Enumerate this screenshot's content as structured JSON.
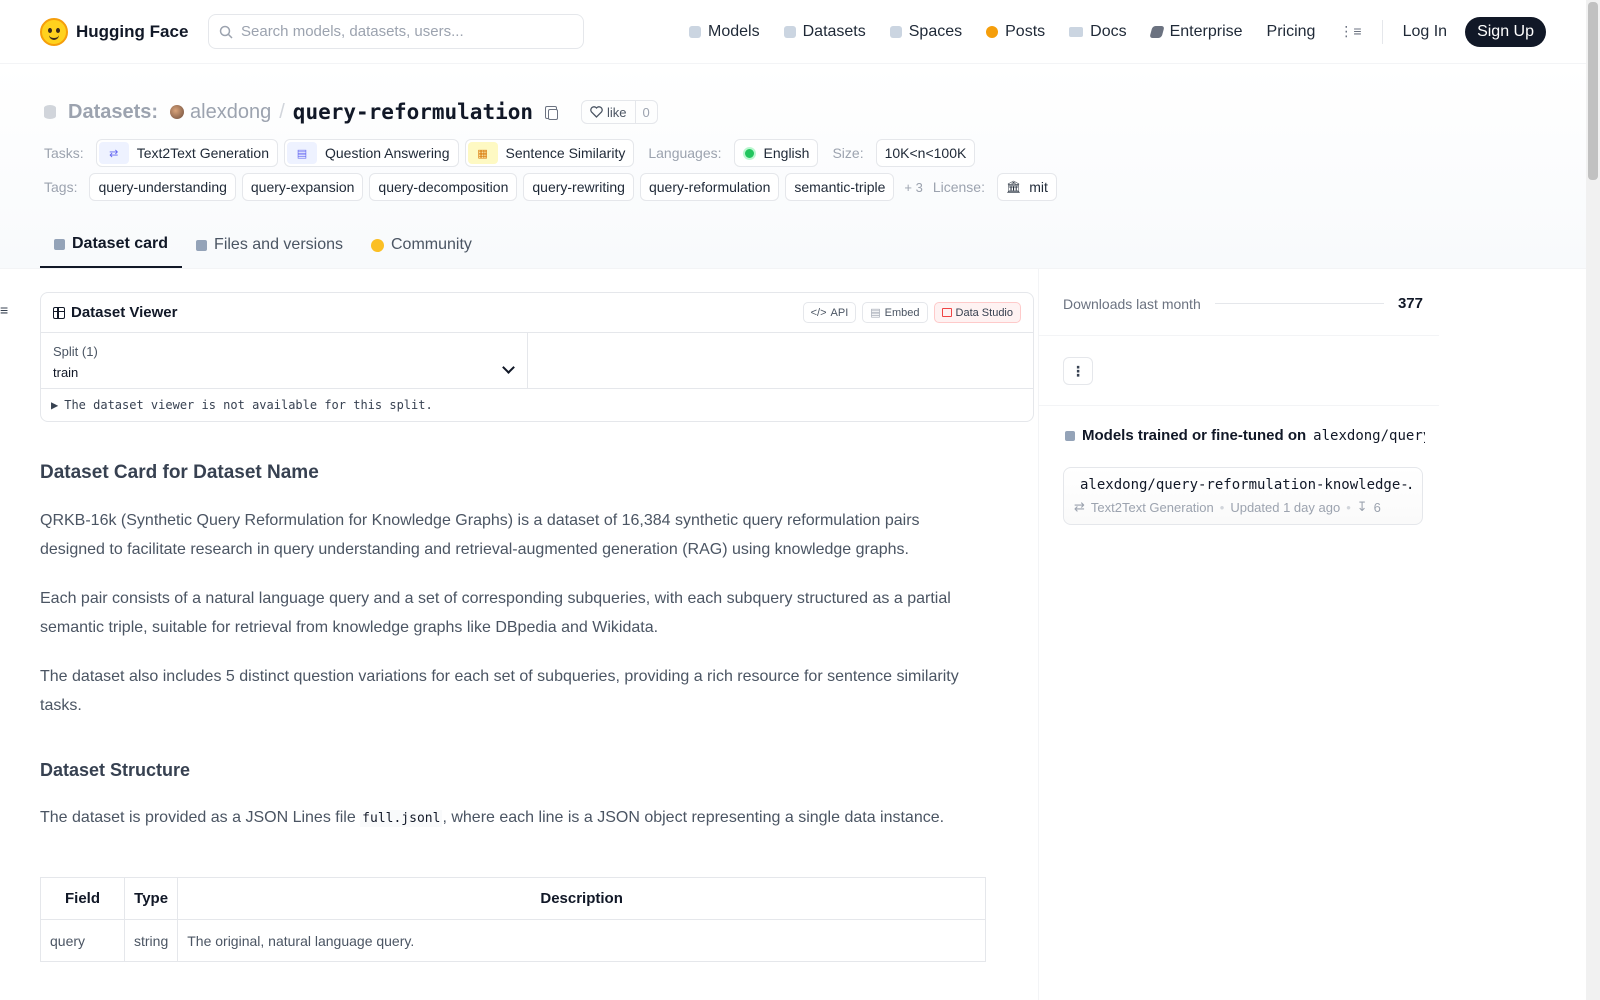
{
  "header": {
    "brand": "Hugging Face",
    "search_placeholder": "Search models, datasets, users...",
    "nav": [
      {
        "label": "Models",
        "icon": "cube-icon"
      },
      {
        "label": "Datasets",
        "icon": "database-icon"
      },
      {
        "label": "Spaces",
        "icon": "grid-icon"
      },
      {
        "label": "Posts",
        "icon": "bubble-icon"
      },
      {
        "label": "Docs",
        "icon": "book-icon"
      },
      {
        "label": "Enterprise",
        "icon": "enterprise-icon"
      },
      {
        "label": "Pricing"
      }
    ],
    "login": "Log In",
    "signup": "Sign Up"
  },
  "repo": {
    "type_label": "Datasets:",
    "owner": "alexdong",
    "slash": "/",
    "name": "query-reformulation",
    "like_label": "like",
    "like_count": "0"
  },
  "meta": {
    "tasks_label": "Tasks:",
    "tasks": [
      "Text2Text Generation",
      "Question Answering",
      "Sentence Similarity"
    ],
    "languages_label": "Languages:",
    "language": "English",
    "size_label": "Size:",
    "size": "10K<n<100K",
    "tags_label": "Tags:",
    "tags": [
      "query-understanding",
      "query-expansion",
      "query-decomposition",
      "query-rewriting",
      "query-reformulation",
      "semantic-triple"
    ],
    "more_tags": "+ 3",
    "license_label": "License:",
    "license": "mit"
  },
  "tabs": [
    "Dataset card",
    "Files and versions",
    "Community"
  ],
  "viewer": {
    "title": "Dataset Viewer",
    "api": "API",
    "embed": "Embed",
    "studio": "Data Studio",
    "split_label": "Split (1)",
    "split_value": "train",
    "note": "The dataset viewer is not available for this split."
  },
  "card": {
    "h2": "Dataset Card for Dataset Name",
    "p1": "QRKB-16k (Synthetic Query Reformulation for Knowledge Graphs) is a dataset of 16,384 synthetic query reformulation pairs designed to facilitate research in query understanding and retrieval-augmented generation (RAG) using knowledge graphs.",
    "p2": "Each pair consists of a natural language query and a set of corresponding subqueries, with each subquery structured as a partial semantic triple, suitable for retrieval from knowledge graphs like DBpedia and Wikidata.",
    "p3": "The dataset also includes 5 distinct question variations for each set of subqueries, providing a rich resource for sentence similarity tasks.",
    "h3": "Dataset Structure",
    "p4_a": "The dataset is provided as a JSON Lines file ",
    "p4_code": "full.jsonl",
    "p4_b": ", where each line is a JSON object representing a single data instance.",
    "table": {
      "headers": [
        "Field",
        "Type",
        "Description"
      ],
      "rows": [
        [
          "query",
          "string",
          "The original, natural language query."
        ]
      ]
    }
  },
  "sidebar": {
    "downloads_label": "Downloads last month",
    "downloads": "377",
    "models_title": "Models trained or fine-tuned on",
    "models_ref": "alexdong/query…",
    "model": {
      "name": "alexdong/query-reformulation-knowledge-…",
      "task": "Text2Text Generation",
      "updated": "Updated 1 day ago",
      "downloads": "6"
    }
  }
}
